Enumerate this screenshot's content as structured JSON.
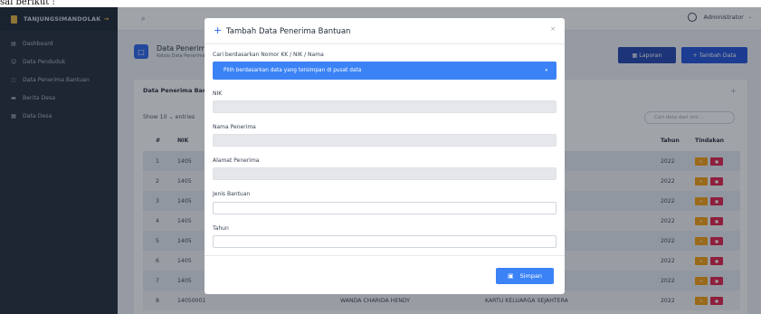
{
  "caption": "sai berikut :",
  "brand": {
    "name": "TANJUNGSIMANDOLAK",
    "tail": "→"
  },
  "sidebar": {
    "items": [
      {
        "icon": "dashboard-icon",
        "glyph": "▤",
        "label": "Dashboard"
      },
      {
        "icon": "user-icon",
        "glyph": "☺",
        "label": "Data Penduduk"
      },
      {
        "icon": "circle-icon",
        "glyph": "○",
        "label": "Data Penerima Bantuan"
      },
      {
        "icon": "news-icon",
        "glyph": "▬",
        "label": "Berita Desa"
      },
      {
        "icon": "grid-icon",
        "glyph": "▦",
        "label": "Data Desa"
      }
    ]
  },
  "topbar": {
    "search_glyph": "⌕",
    "user": "Administrator",
    "caret": "⌄"
  },
  "page": {
    "title": "Data Penerima Bantuan",
    "subtitle": "Kelola Data Penerima Bantuan",
    "laporan_label": "▦  Laporan",
    "tambah_label": "+  Tambah Data"
  },
  "card": {
    "title": "Data Penerima Bantuan",
    "expand_glyph": "+",
    "show_label": "Show  10  ⌄  entries",
    "search_placeholder": "Cari data dari sini..."
  },
  "table": {
    "headers": {
      "no": "#",
      "nik": "NIK",
      "nama": "",
      "alamat": "",
      "tahun": "Tahun",
      "aksi": "Tindakan"
    },
    "rows": [
      {
        "no": "1",
        "nik": "1405",
        "nama": "",
        "alamat": "",
        "tahun": "2022"
      },
      {
        "no": "2",
        "nik": "1405",
        "nama": "",
        "alamat": "",
        "tahun": "2022"
      },
      {
        "no": "3",
        "nik": "1405",
        "nama": "",
        "alamat": "",
        "tahun": "2022"
      },
      {
        "no": "4",
        "nik": "1405",
        "nama": "",
        "alamat": "",
        "tahun": "2022"
      },
      {
        "no": "5",
        "nik": "1405",
        "nama": "",
        "alamat": "",
        "tahun": "2022"
      },
      {
        "no": "6",
        "nik": "1405",
        "nama": "",
        "alamat": "",
        "tahun": "2022"
      },
      {
        "no": "7",
        "nik": "1405",
        "nama": "",
        "alamat": "",
        "tahun": "2022"
      },
      {
        "no": "8",
        "nik": "14050001",
        "nama": "WANDA CHARIDA HENDY",
        "alamat": "KARTU KELUARGA SEJAHTERA",
        "tahun": "2022"
      }
    ]
  },
  "modal": {
    "plus": "+",
    "title": "Tambah Data Penerima Bantuan",
    "close": "×",
    "search_label": "Cari berdasarkan Nomor KK / NIK / Nama",
    "select_text": "Pilih berdasarkan data yang tersimpan di pusat data",
    "select_caret": "▾",
    "nik_label": "NIK",
    "nama_label": "Nama Penerima",
    "alamat_label": "Alamat Penerima",
    "jenis_label": "Jenis Bantuan",
    "tahun_label": "Tahun",
    "save_label": "Simpan",
    "save_glyph": "▣"
  },
  "colors": {
    "primary": "#3b82f6",
    "sidebar": "#1f2937",
    "edit": "#f59e0b",
    "delete": "#e11d48"
  }
}
